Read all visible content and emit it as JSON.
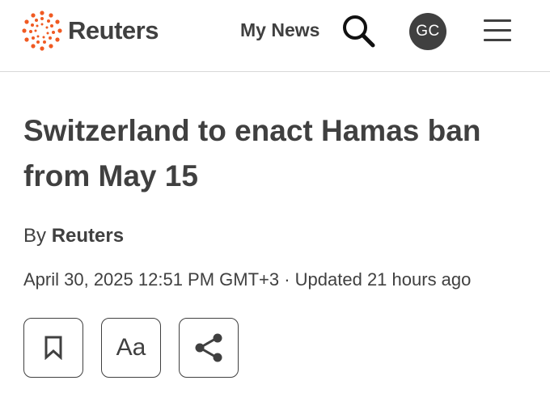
{
  "header": {
    "logo_text": "Reuters",
    "my_news_label": "My News",
    "avatar_initials": "GC",
    "search_icon": "search-icon",
    "menu_icon": "hamburger-menu-icon"
  },
  "article": {
    "headline": "Switzerland to enact Hamas ban from May 15",
    "byline_prefix": "By",
    "byline_author": "Reuters",
    "dateline": "April 30, 2025 12:51 PM GMT+3 · Updated 21 hours ago"
  },
  "toolbar": {
    "bookmark_icon": "bookmark-icon",
    "text_size_label": "Aa",
    "share_icon": "share-icon"
  },
  "colors": {
    "text": "#404040",
    "logo_accent": "#f05a22",
    "divider": "#d9d9d9"
  }
}
